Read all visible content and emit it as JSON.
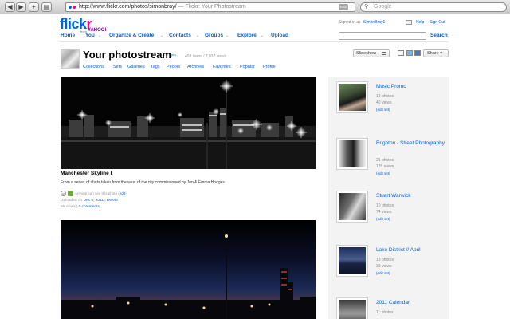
{
  "browser": {
    "url": "http://www.flickr.com/photos/simonbray/",
    "url_title": " — Flickr: Your Photostream",
    "rss_label": "RSS",
    "search_placeholder": "Google",
    "back_icon": "left-arrow",
    "forward_icon": "right-arrow",
    "add_icon": "plus",
    "print_icon": "printer"
  },
  "header": {
    "logo_main": "flick",
    "logo_r": "r",
    "logo_from": "from",
    "logo_yahoo": "YAHOO!",
    "signed_in_prefix": "Signed in as",
    "username": "SimonBray1",
    "help": "Help",
    "sign_out": "Sign Out",
    "nav": {
      "home": "Home",
      "you": "You",
      "organize": "Organize & Create",
      "contacts": "Contacts",
      "groups": "Groups",
      "explore": "Explore",
      "upload": "Upload"
    },
    "dropdown_glyph": "▼",
    "search_button": "Search"
  },
  "profile": {
    "title": "Your photostream",
    "pro_badge": "pro",
    "stats": "493 items / 7,037 views",
    "subnav": {
      "collections": "Collections",
      "sets": "Sets",
      "galleries": "Galleries",
      "tags": "Tags",
      "people": "People",
      "archives": "Archives",
      "favorites": "Favorites",
      "popular": "Popular",
      "profile": "Profile"
    },
    "slideshow": "Slideshow",
    "share": "Share ▾"
  },
  "photos": [
    {
      "title": "Manchester Skyline I",
      "description": "From a series of shots taken from the west of the city commissioned by Jon & Emma Hodges.",
      "license_icon": "cc",
      "privacy_text": "Anyone can see this photo (",
      "privacy_edit": "edit",
      "privacy_close": ")",
      "uploaded_prefix": "Uploaded on",
      "uploaded_date": "Dec 5, 2011",
      "sep": "|",
      "delete": "Delete",
      "views": "66 views",
      "comments": "0 comments"
    }
  ],
  "sets": [
    {
      "title": "Music Promo",
      "photos": "12 photos",
      "views": "40 views",
      "edit": "(edit set)"
    },
    {
      "title": "Brighton - Street Photography",
      "photos": "21 photos",
      "views": "135 views",
      "edit": "(edit set)"
    },
    {
      "title": "Stuart Warwick",
      "photos": "10 photos",
      "views": "74 views",
      "edit": "(edit set)"
    },
    {
      "title": "Lake District // April",
      "photos": "18 photos",
      "views": "33 views",
      "edit": "(edit set)"
    },
    {
      "title": "2011 Calendar",
      "photos": "11 photos",
      "views": "",
      "edit": ""
    }
  ],
  "colors": {
    "flickr_blue": "#0063dc",
    "flickr_pink": "#ff0084",
    "yahoo_purple": "#7b0099"
  }
}
